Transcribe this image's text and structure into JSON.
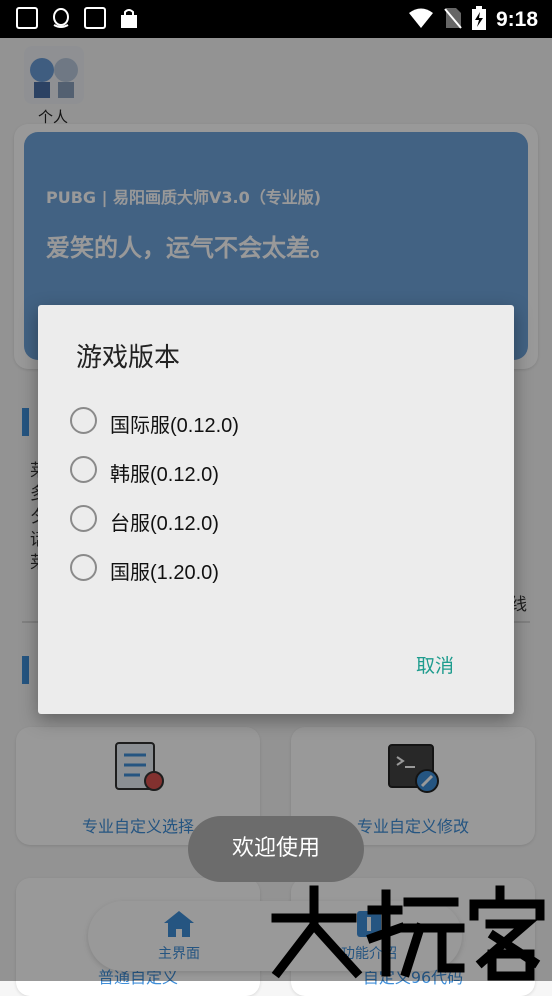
{
  "status_bar": {
    "time": "9:18"
  },
  "profile": {
    "label": "个人"
  },
  "banner": {
    "subtitle": "PUBG | 易阳画质大师V3.0（专业版)",
    "quote": "爱笑的人，运气不会太差。"
  },
  "partial_text": {
    "left_col": [
      "莱",
      "多",
      "夕",
      "话",
      "莱"
    ],
    "right_char": "线"
  },
  "tiles": [
    {
      "label": "专业自定义选择",
      "icon": "list-doc-icon"
    },
    {
      "label": "专业自定义修改",
      "icon": "terminal-edit-icon"
    },
    {
      "label": "普通自定义",
      "icon": "brush-icon"
    },
    {
      "label": "自定义96代码",
      "icon": "code-icon"
    }
  ],
  "bottom_nav": {
    "items": [
      {
        "label": "主界面",
        "icon": "home-icon"
      },
      {
        "label": "功能介绍",
        "icon": "info-icon"
      }
    ]
  },
  "dialog": {
    "title": "游戏版本",
    "options": [
      {
        "label": "国际服(0.12.0)"
      },
      {
        "label": "韩服(0.12.0)"
      },
      {
        "label": "台服(0.12.0)"
      },
      {
        "label": "国服(1.20.0)"
      }
    ],
    "cancel_label": "取消"
  },
  "toast": {
    "text": "欢迎使用"
  },
  "watermark": {
    "text": "大玩客"
  },
  "colors": {
    "accent": "#3f8ed8",
    "banner": "#6fa3db",
    "dialog_button": "#1e9c8e"
  }
}
